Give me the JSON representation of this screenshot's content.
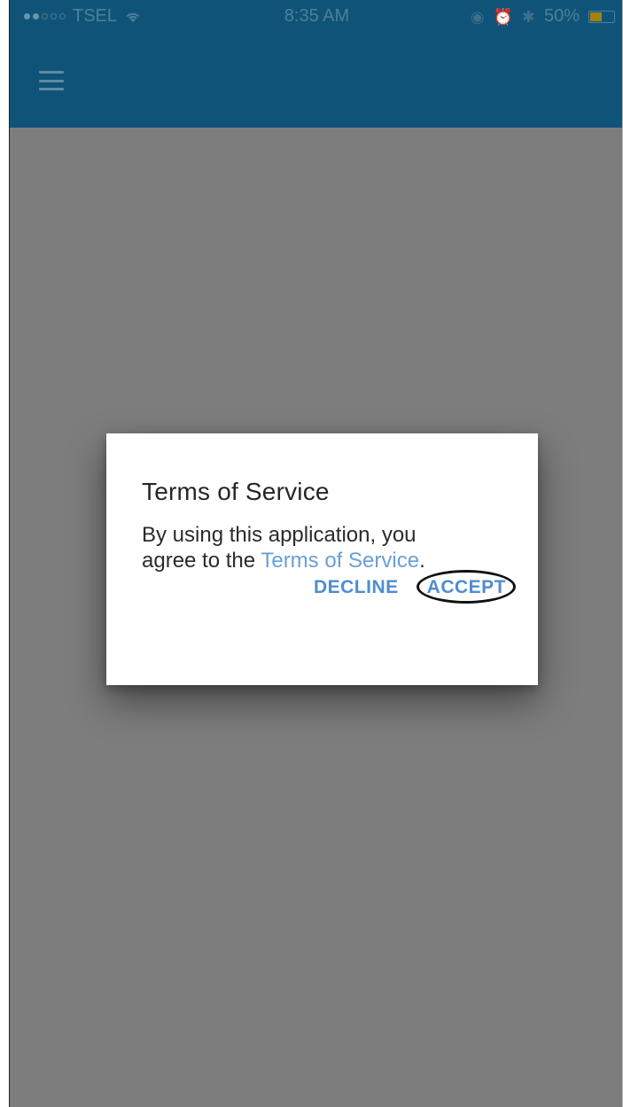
{
  "status_bar": {
    "carrier": "TSEL",
    "time": "8:35 AM",
    "battery_percent": "50%",
    "battery_level": 0.5,
    "icons": [
      "signal-dots-icon",
      "wifi-icon",
      "location-icon",
      "alarm-icon",
      "bluetooth-icon",
      "battery-icon"
    ]
  },
  "header": {
    "menu_icon": "hamburger-menu-icon",
    "color": "#0f5478"
  },
  "overlay_color": "#7d7d7d",
  "dialog": {
    "title": "Terms of Service",
    "body_prefix": "By using this application, you agree to the ",
    "link_text": "Terms of Service",
    "body_suffix": ".",
    "decline_label": "DECLINE",
    "accept_label": "ACCEPT",
    "link_color": "#6a9fd8",
    "button_color": "#4f8dd0"
  }
}
